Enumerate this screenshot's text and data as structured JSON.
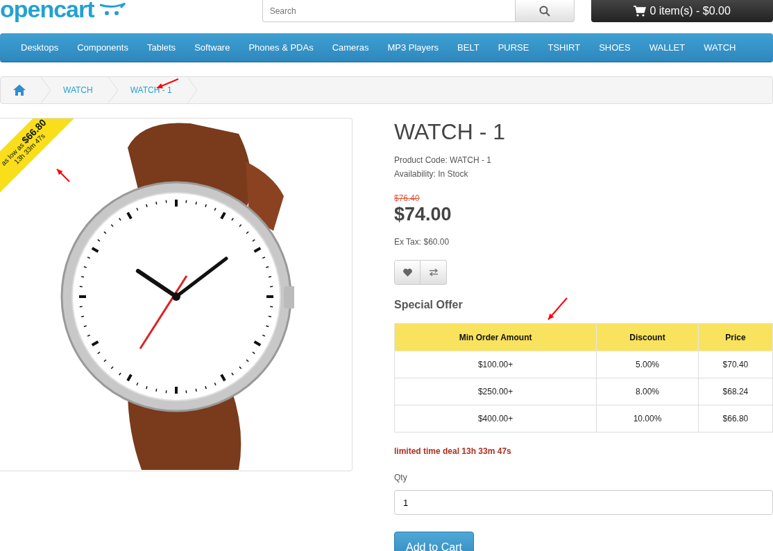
{
  "header": {
    "logo": "opencart",
    "search": {
      "placeholder": "Search"
    },
    "cart": "0 item(s) - $0.00"
  },
  "nav": [
    "Desktops",
    "Components",
    "Tablets",
    "Software",
    "Phones & PDAs",
    "Cameras",
    "MP3 Players",
    "BELT",
    "PURSE",
    "TSHIRT",
    "SHOES",
    "WALLET",
    "WATCH"
  ],
  "breadcrumb": [
    "WATCH",
    "WATCH - 1"
  ],
  "ribbon": {
    "prefix": "as low as",
    "price": "$66.80",
    "countdown": "13h 33m 47s"
  },
  "product": {
    "title": "WATCH - 1",
    "code": "Product Code: WATCH - 1",
    "availability": "Availability: In Stock",
    "old_price": "$76.40",
    "price": "$74.00",
    "ex_tax": "Ex Tax: $60.00"
  },
  "special_offer": {
    "title": "Special Offer",
    "columns": [
      "Min Order Amount",
      "Discount",
      "Price"
    ],
    "rows": [
      [
        "$100.00+",
        "5.00%",
        "$70.40"
      ],
      [
        "$250.00+",
        "8.00%",
        "$68.24"
      ],
      [
        "$400.00+",
        "10.00%",
        "$66.80"
      ]
    ]
  },
  "deal": "limited time deal 13h 33m 47s",
  "qty": {
    "label": "Qty",
    "value": "1"
  },
  "add_to_cart": "Add to Cart"
}
